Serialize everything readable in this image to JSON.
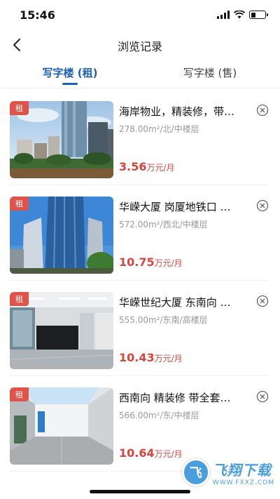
{
  "status": {
    "time": "15:46",
    "battery_level": 0.35
  },
  "nav": {
    "title": "浏览记录"
  },
  "tabs": [
    {
      "label": "写字楼 (租)",
      "active": true
    },
    {
      "label": "写字楼 (售)",
      "active": false
    }
  ],
  "listings": [
    {
      "tag": "租",
      "title": "海岸物业，精装修，带…",
      "meta": "278.00m²/北/中楼层",
      "price": "3.56",
      "unit": "万元/月",
      "image": "tower-skyline"
    },
    {
      "tag": "租",
      "title": "华嵘大厦 岗厦地铁口 …",
      "meta": "572.00m²/西北/中楼层",
      "price": "10.75",
      "unit": "万元/月",
      "image": "glass-tower"
    },
    {
      "tag": "租",
      "title": "华嵘世纪大厦 东南向 …",
      "meta": "555.00m²/东南/高楼层",
      "price": "10.43",
      "unit": "万元/月",
      "image": "office-lobby"
    },
    {
      "tag": "租",
      "title": "西南向 精装修 带全套…",
      "meta": "566.00m²/东/中楼层",
      "price": "10.64",
      "unit": "万元/月",
      "image": "office-room"
    }
  ],
  "watermark": {
    "logo": "飞",
    "main": "飞翔下载",
    "sub": "WWW.FXXZ.COM"
  },
  "colors": {
    "accent": "#1a5fb4",
    "price": "#d8453c",
    "tag": "#e0534a"
  }
}
